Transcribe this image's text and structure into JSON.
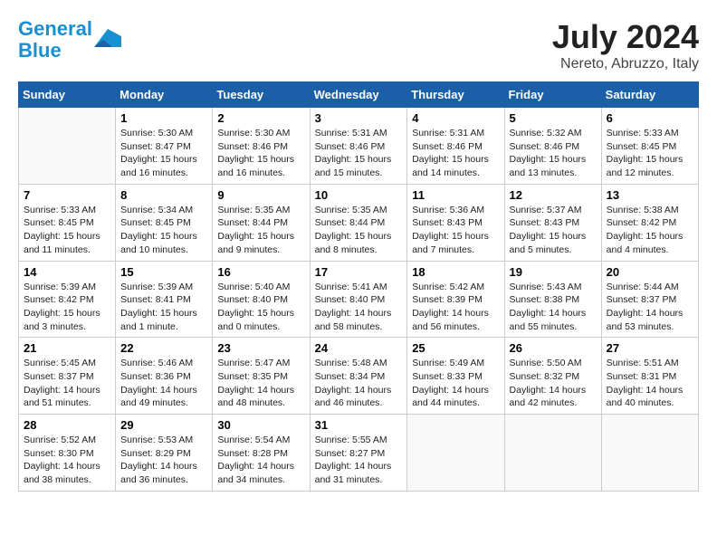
{
  "header": {
    "logo_line1": "General",
    "logo_line2": "Blue",
    "month_title": "July 2024",
    "location": "Nereto, Abruzzo, Italy"
  },
  "days_of_week": [
    "Sunday",
    "Monday",
    "Tuesday",
    "Wednesday",
    "Thursday",
    "Friday",
    "Saturday"
  ],
  "weeks": [
    [
      {
        "day": "",
        "empty": true
      },
      {
        "day": "1",
        "sunrise": "Sunrise: 5:30 AM",
        "sunset": "Sunset: 8:47 PM",
        "daylight": "Daylight: 15 hours and 16 minutes."
      },
      {
        "day": "2",
        "sunrise": "Sunrise: 5:30 AM",
        "sunset": "Sunset: 8:46 PM",
        "daylight": "Daylight: 15 hours and 16 minutes."
      },
      {
        "day": "3",
        "sunrise": "Sunrise: 5:31 AM",
        "sunset": "Sunset: 8:46 PM",
        "daylight": "Daylight: 15 hours and 15 minutes."
      },
      {
        "day": "4",
        "sunrise": "Sunrise: 5:31 AM",
        "sunset": "Sunset: 8:46 PM",
        "daylight": "Daylight: 15 hours and 14 minutes."
      },
      {
        "day": "5",
        "sunrise": "Sunrise: 5:32 AM",
        "sunset": "Sunset: 8:46 PM",
        "daylight": "Daylight: 15 hours and 13 minutes."
      },
      {
        "day": "6",
        "sunrise": "Sunrise: 5:33 AM",
        "sunset": "Sunset: 8:45 PM",
        "daylight": "Daylight: 15 hours and 12 minutes."
      }
    ],
    [
      {
        "day": "7",
        "sunrise": "Sunrise: 5:33 AM",
        "sunset": "Sunset: 8:45 PM",
        "daylight": "Daylight: 15 hours and 11 minutes."
      },
      {
        "day": "8",
        "sunrise": "Sunrise: 5:34 AM",
        "sunset": "Sunset: 8:45 PM",
        "daylight": "Daylight: 15 hours and 10 minutes."
      },
      {
        "day": "9",
        "sunrise": "Sunrise: 5:35 AM",
        "sunset": "Sunset: 8:44 PM",
        "daylight": "Daylight: 15 hours and 9 minutes."
      },
      {
        "day": "10",
        "sunrise": "Sunrise: 5:35 AM",
        "sunset": "Sunset: 8:44 PM",
        "daylight": "Daylight: 15 hours and 8 minutes."
      },
      {
        "day": "11",
        "sunrise": "Sunrise: 5:36 AM",
        "sunset": "Sunset: 8:43 PM",
        "daylight": "Daylight: 15 hours and 7 minutes."
      },
      {
        "day": "12",
        "sunrise": "Sunrise: 5:37 AM",
        "sunset": "Sunset: 8:43 PM",
        "daylight": "Daylight: 15 hours and 5 minutes."
      },
      {
        "day": "13",
        "sunrise": "Sunrise: 5:38 AM",
        "sunset": "Sunset: 8:42 PM",
        "daylight": "Daylight: 15 hours and 4 minutes."
      }
    ],
    [
      {
        "day": "14",
        "sunrise": "Sunrise: 5:39 AM",
        "sunset": "Sunset: 8:42 PM",
        "daylight": "Daylight: 15 hours and 3 minutes."
      },
      {
        "day": "15",
        "sunrise": "Sunrise: 5:39 AM",
        "sunset": "Sunset: 8:41 PM",
        "daylight": "Daylight: 15 hours and 1 minute."
      },
      {
        "day": "16",
        "sunrise": "Sunrise: 5:40 AM",
        "sunset": "Sunset: 8:40 PM",
        "daylight": "Daylight: 15 hours and 0 minutes."
      },
      {
        "day": "17",
        "sunrise": "Sunrise: 5:41 AM",
        "sunset": "Sunset: 8:40 PM",
        "daylight": "Daylight: 14 hours and 58 minutes."
      },
      {
        "day": "18",
        "sunrise": "Sunrise: 5:42 AM",
        "sunset": "Sunset: 8:39 PM",
        "daylight": "Daylight: 14 hours and 56 minutes."
      },
      {
        "day": "19",
        "sunrise": "Sunrise: 5:43 AM",
        "sunset": "Sunset: 8:38 PM",
        "daylight": "Daylight: 14 hours and 55 minutes."
      },
      {
        "day": "20",
        "sunrise": "Sunrise: 5:44 AM",
        "sunset": "Sunset: 8:37 PM",
        "daylight": "Daylight: 14 hours and 53 minutes."
      }
    ],
    [
      {
        "day": "21",
        "sunrise": "Sunrise: 5:45 AM",
        "sunset": "Sunset: 8:37 PM",
        "daylight": "Daylight: 14 hours and 51 minutes."
      },
      {
        "day": "22",
        "sunrise": "Sunrise: 5:46 AM",
        "sunset": "Sunset: 8:36 PM",
        "daylight": "Daylight: 14 hours and 49 minutes."
      },
      {
        "day": "23",
        "sunrise": "Sunrise: 5:47 AM",
        "sunset": "Sunset: 8:35 PM",
        "daylight": "Daylight: 14 hours and 48 minutes."
      },
      {
        "day": "24",
        "sunrise": "Sunrise: 5:48 AM",
        "sunset": "Sunset: 8:34 PM",
        "daylight": "Daylight: 14 hours and 46 minutes."
      },
      {
        "day": "25",
        "sunrise": "Sunrise: 5:49 AM",
        "sunset": "Sunset: 8:33 PM",
        "daylight": "Daylight: 14 hours and 44 minutes."
      },
      {
        "day": "26",
        "sunrise": "Sunrise: 5:50 AM",
        "sunset": "Sunset: 8:32 PM",
        "daylight": "Daylight: 14 hours and 42 minutes."
      },
      {
        "day": "27",
        "sunrise": "Sunrise: 5:51 AM",
        "sunset": "Sunset: 8:31 PM",
        "daylight": "Daylight: 14 hours and 40 minutes."
      }
    ],
    [
      {
        "day": "28",
        "sunrise": "Sunrise: 5:52 AM",
        "sunset": "Sunset: 8:30 PM",
        "daylight": "Daylight: 14 hours and 38 minutes."
      },
      {
        "day": "29",
        "sunrise": "Sunrise: 5:53 AM",
        "sunset": "Sunset: 8:29 PM",
        "daylight": "Daylight: 14 hours and 36 minutes."
      },
      {
        "day": "30",
        "sunrise": "Sunrise: 5:54 AM",
        "sunset": "Sunset: 8:28 PM",
        "daylight": "Daylight: 14 hours and 34 minutes."
      },
      {
        "day": "31",
        "sunrise": "Sunrise: 5:55 AM",
        "sunset": "Sunset: 8:27 PM",
        "daylight": "Daylight: 14 hours and 31 minutes."
      },
      {
        "day": "",
        "empty": true
      },
      {
        "day": "",
        "empty": true
      },
      {
        "day": "",
        "empty": true
      }
    ]
  ]
}
